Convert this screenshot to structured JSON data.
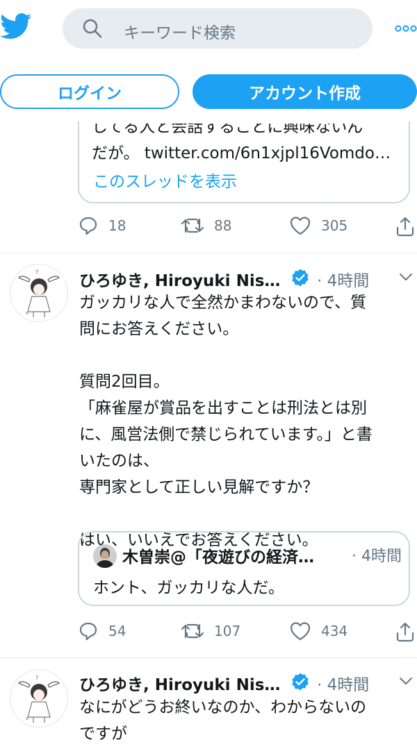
{
  "header": {
    "logo_icon": "twitter-bird-icon",
    "search_placeholder": "キーワード検索",
    "more_icon": "more-dots-icon",
    "login_label": "ログイン",
    "signup_label": "アカウント作成",
    "brand_color": "#1da1f2"
  },
  "prev_tweet": {
    "quote_line1": "してる人と会話することに興味ないん",
    "quote_line2": "だが。 twitter.com/6n1xjpl16Vomdo…",
    "show_thread": "このスレッドを表示",
    "replies": "18",
    "retweets": "88",
    "likes": "305"
  },
  "tweet1": {
    "name": "ひろゆき, Hiroyuki Nis…",
    "time": "· 4時間",
    "body": "ガッカリな人で全然かまわないので、質\n問にお答えください。\n\n質問2回目。\n「麻雀屋が賞品を出すことは刑法とは別\nに、風営法側で禁じられています。」と書\nいたのは、\n専門家として正しい見解ですか？\n\nはい、いいえでお答えください。",
    "quote": {
      "name": "木曽崇@「夜遊びの経済…",
      "time": "· 4時間",
      "text": "ホント、ガッカリな人だ。"
    },
    "replies": "54",
    "retweets": "107",
    "likes": "434"
  },
  "tweet2": {
    "name": "ひろゆき, Hiroyuki Nis…",
    "time": "· 4時間",
    "body": "なにがどうお終いなのか、わからないの\nですが"
  }
}
